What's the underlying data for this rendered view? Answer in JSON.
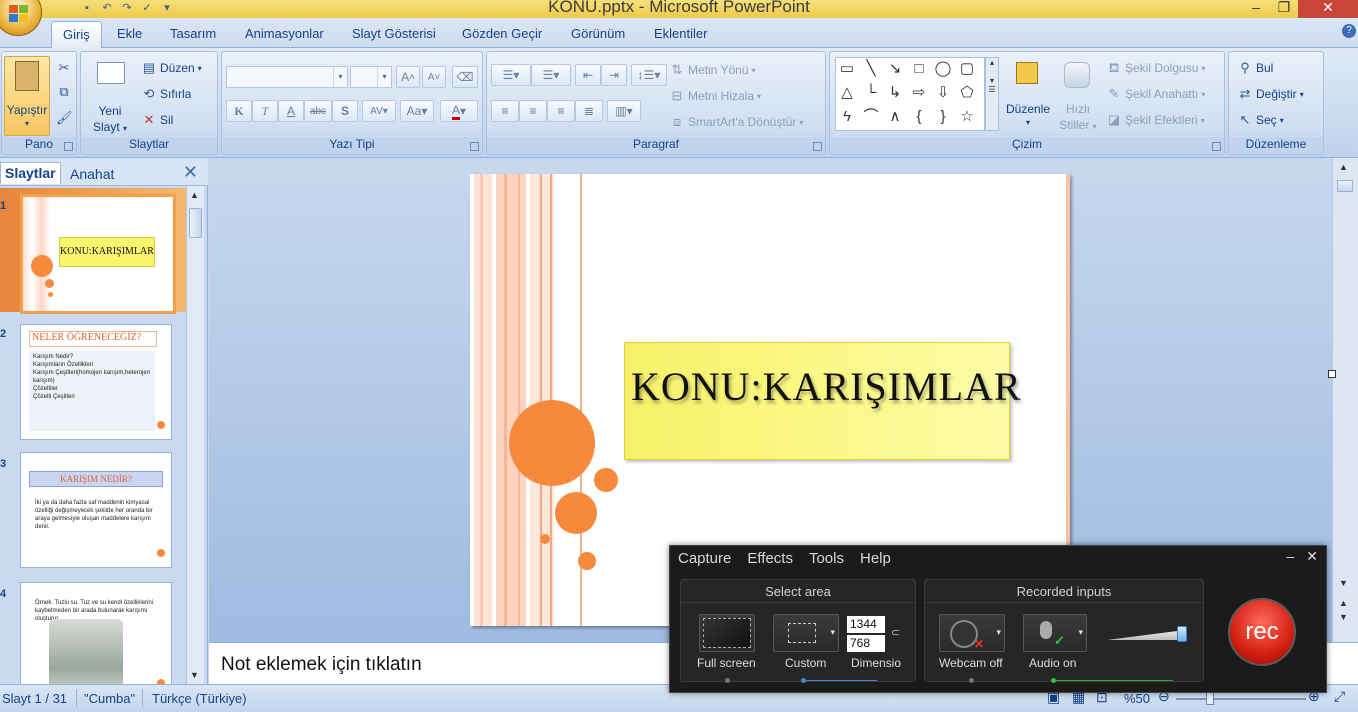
{
  "window": {
    "title": "KONU.pptx - Microsoft PowerPoint"
  },
  "ribbon": {
    "tabs": [
      "Giriş",
      "Ekle",
      "Tasarım",
      "Animasyonlar",
      "Slayt Gösterisi",
      "Gözden Geçir",
      "Görünüm",
      "Eklentiler"
    ],
    "pano": {
      "paste": "Yapıştır",
      "label": "Pano"
    },
    "slaytlar": {
      "new_slide_line1": "Yeni",
      "new_slide_line2": "Slayt",
      "duzen": "Düzen",
      "sifirla": "Sıfırla",
      "sil": "Sil",
      "label": "Slaytlar"
    },
    "yazi_tipi": {
      "label": "Yazı Tipi",
      "bold": "K",
      "italic": "T",
      "underline": "A",
      "strike": "abc",
      "shadow": "S",
      "spacing": "AV",
      "case": "Aa",
      "grow": "A",
      "shrink": "A"
    },
    "paragraf": {
      "label": "Paragraf",
      "direction": "Metin Yönü",
      "align": "Metni Hizala",
      "smartart": "SmartArt'a Dönüştür"
    },
    "cizim": {
      "label": "Çizim",
      "arrange": "Düzenle",
      "quick_line1": "Hızlı",
      "quick_line2": "Stiller",
      "fill": "Şekil Dolgusu",
      "outline": "Şekil Anahattı",
      "effects": "Şekil Efektleri"
    },
    "duzenleme": {
      "label": "Düzenleme",
      "find": "Bul",
      "replace": "Değiştir",
      "select": "Seç"
    }
  },
  "left_pane": {
    "tabs": [
      "Slaytlar",
      "Anahat"
    ],
    "thumbs": [
      {
        "num": "1",
        "text": "KONU:KARIŞIMLAR"
      },
      {
        "num": "2",
        "title": "NELER ÖĞRENECEĞİZ?",
        "bullets": [
          "Karışım Nedir?",
          "Karışımların Özellikleri",
          "Karışım Çeşitleri(homojen karışım,heterojen karışım)",
          "Çözeltiler",
          "Çözelti Çeşitleri"
        ]
      },
      {
        "num": "3",
        "title": "KARIŞIM NEDİR?",
        "text": "İki ya da daha fazla saf maddenin kimyasal özelliği değişmeyecek şekilde her oranda bir araya gelmesiyle oluşan maddelere karışım denir."
      },
      {
        "num": "4",
        "text": "Örnek. Tuzlu su. Tuz ve su kendi özelliklerini kaybetmeden bir arada bulunarak karışımı oluşturur."
      }
    ]
  },
  "slide": {
    "title": "KONU:KARIŞIMLAR"
  },
  "notes": {
    "placeholder": "Not eklemek için tıklatın"
  },
  "statusbar": {
    "slide": "Slayt 1 / 31",
    "theme": "\"Cumba\"",
    "language": "Türkçe (Türkiye)",
    "zoom": "%50"
  },
  "recorder": {
    "menu": [
      "Capture",
      "Effects",
      "Tools",
      "Help"
    ],
    "select_area": "Select area",
    "full_screen": "Full screen",
    "custom": "Custom",
    "width": "1344",
    "height": "768",
    "dimensions": "Dimensio",
    "recorded_inputs": "Recorded inputs",
    "webcam": "Webcam off",
    "audio": "Audio on",
    "rec": "rec"
  },
  "colors": {
    "accent_orange": "#f6893b",
    "ribbon_blue": "#15428b",
    "rec_red": "#d21f12"
  }
}
